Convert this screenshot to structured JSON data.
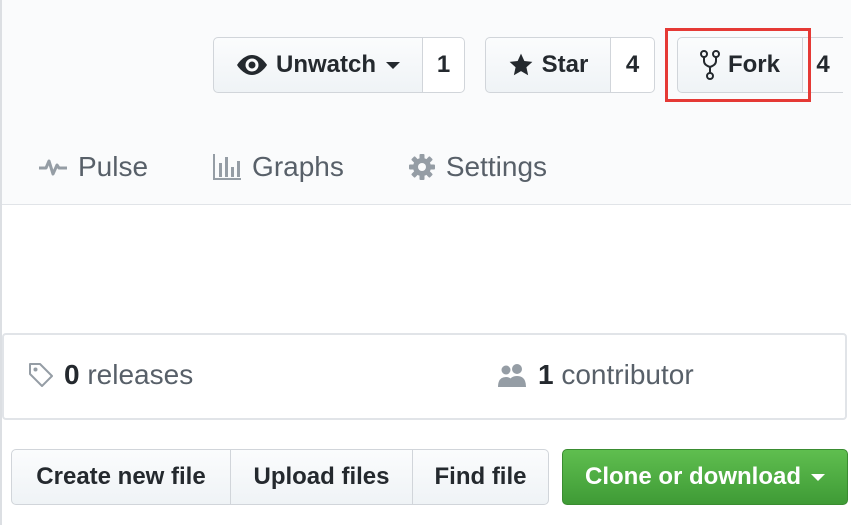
{
  "actions": {
    "watch": {
      "label": "Unwatch",
      "count": "1"
    },
    "star": {
      "label": "Star",
      "count": "4"
    },
    "fork": {
      "label": "Fork",
      "count": "4"
    }
  },
  "nav": {
    "pulse": "Pulse",
    "graphs": "Graphs",
    "settings": "Settings"
  },
  "summary": {
    "releases": {
      "count": "0",
      "label": "releases"
    },
    "contributors": {
      "count": "1",
      "label": "contributor"
    }
  },
  "file_actions": {
    "create": "Create new file",
    "upload": "Upload files",
    "find": "Find file",
    "clone": "Clone or download"
  },
  "colors": {
    "highlight": "#e53935",
    "primary_green": "#3f9b36",
    "text_muted": "#586069"
  },
  "icons": {
    "watch": "eye-icon",
    "star": "star-icon",
    "fork": "fork-icon",
    "pulse": "pulse-icon",
    "graphs": "graph-icon",
    "settings": "gear-icon",
    "releases": "tag-icon",
    "contributors": "people-icon"
  }
}
